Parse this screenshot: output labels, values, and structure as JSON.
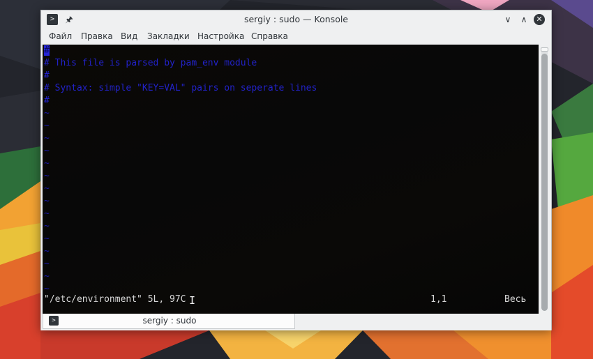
{
  "window": {
    "title": "sergiy : sudo — Konsole",
    "app_icon": "terminal-icon",
    "pin_icon": "pin-icon",
    "controls": {
      "minimize": "chevron-down-icon",
      "maximize": "chevron-up-icon",
      "close": "close-icon"
    }
  },
  "menubar": {
    "items": [
      {
        "label": "Файл"
      },
      {
        "label": "Правка"
      },
      {
        "label": "Вид"
      },
      {
        "label": "Закладки"
      },
      {
        "label": "Настройка"
      },
      {
        "label": "Справка"
      }
    ]
  },
  "terminal": {
    "lines": [
      {
        "prefix": "#",
        "text": "",
        "cursor": true
      },
      {
        "prefix": "#",
        "text": " This file is parsed by pam_env module"
      },
      {
        "prefix": "#",
        "text": ""
      },
      {
        "prefix": "#",
        "text": " Syntax: simple \"KEY=VAL\" pairs on seperate lines"
      },
      {
        "prefix": "#",
        "text": ""
      }
    ],
    "tilde": "~",
    "status": {
      "file": "\"/etc/environment\" 5L, 97C",
      "position": "1,1",
      "scroll": "Весь"
    },
    "colors": {
      "background": "#070707",
      "comment": "#2222c8",
      "text": "#d8d8d8"
    }
  },
  "tabbar": {
    "tabs": [
      {
        "label": "sergiy : sudo",
        "icon": "terminal-icon"
      }
    ]
  },
  "theme": {
    "window_bg": "#eff0f1",
    "text": "#31363b"
  }
}
